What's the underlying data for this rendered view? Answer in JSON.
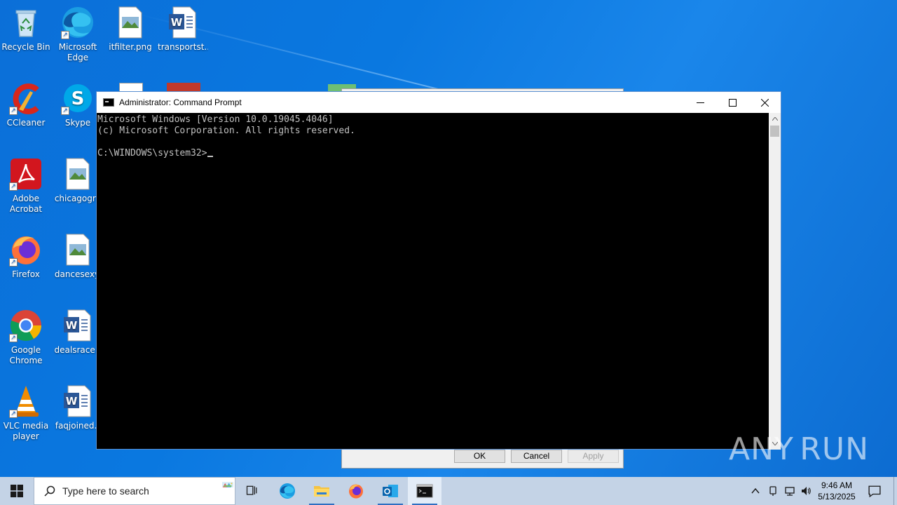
{
  "desktop": {
    "icons": [
      {
        "label": "Recycle Bin",
        "icon": "recycle-bin-icon"
      },
      {
        "label": "Microsoft Edge",
        "icon": "edge-icon"
      },
      {
        "label": "itfilter.png",
        "icon": "image-file-icon"
      },
      {
        "label": "transportst...",
        "icon": "word-doc-icon"
      },
      {
        "label": "CCleaner",
        "icon": "ccleaner-icon"
      },
      {
        "label": "Skype",
        "icon": "skype-icon"
      },
      {
        "label": "Adobe Acrobat",
        "icon": "acrobat-icon"
      },
      {
        "label": "chicagogra",
        "icon": "image-file-icon"
      },
      {
        "label": "Firefox",
        "icon": "firefox-icon"
      },
      {
        "label": "dancesexy.",
        "icon": "image-file-icon"
      },
      {
        "label": "Google Chrome",
        "icon": "chrome-icon"
      },
      {
        "label": "dealsrace.r",
        "icon": "word-doc-icon"
      },
      {
        "label": "VLC media player",
        "icon": "vlc-icon"
      },
      {
        "label": "faqjoined.r",
        "icon": "word-doc-icon"
      }
    ]
  },
  "background_dialog": {
    "ok_label": "OK",
    "cancel_label": "Cancel",
    "apply_label": "Apply"
  },
  "cmd_window": {
    "title": "Administrator: Command Prompt",
    "lines": [
      "Microsoft Windows [Version 10.0.19045.4046]",
      "(c) Microsoft Corporation. All rights reserved.",
      "",
      "C:\\WINDOWS\\system32>"
    ]
  },
  "watermark": {
    "left": "ANY",
    "right": "RUN"
  },
  "taskbar": {
    "search_placeholder": "Type here to search",
    "apps": [
      "task-view-icon",
      "edge-icon",
      "file-explorer-icon",
      "firefox-icon",
      "outlook-icon",
      "cmd-icon"
    ],
    "clock_time": "9:46 AM",
    "clock_date": "5/13/2025"
  },
  "colors": {
    "desktop_blue": "#0a78e0",
    "taskbar": "#c4d3e6",
    "console_bg": "#000000",
    "console_fg": "#c0c0c0"
  }
}
